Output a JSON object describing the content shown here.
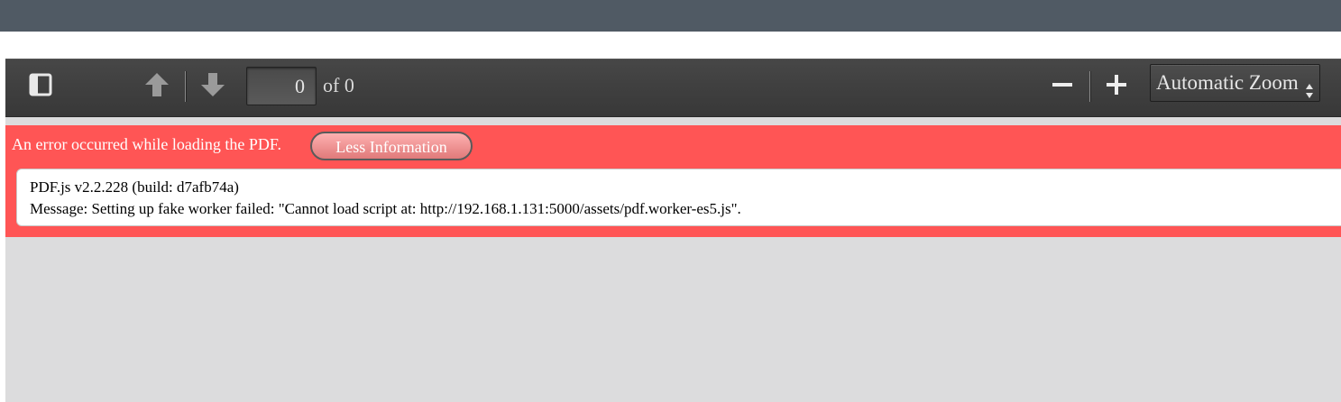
{
  "toolbar": {
    "page_number": "0",
    "page_count": "of 0",
    "zoom": "Automatic Zoom"
  },
  "error": {
    "message": "An error occurred while loading the PDF.",
    "less_info_label": "Less Information",
    "version_line": "PDF.js v2.2.228 (build: d7afb74a)",
    "detail_line": "Message: Setting up fake worker failed: \"Cannot load script at: http://192.168.1.131:5000/assets/pdf.worker-es5.js\"."
  },
  "colors": {
    "header": "#505a64",
    "toolbar": "#3f3f3f",
    "error_bar": "#ff5555",
    "viewer_bg": "#dcdcdd"
  },
  "icons": [
    "sidebar-toggle-icon",
    "arrow-up-icon",
    "arrow-down-icon",
    "minus-icon",
    "plus-icon",
    "select-arrows-icon"
  ]
}
